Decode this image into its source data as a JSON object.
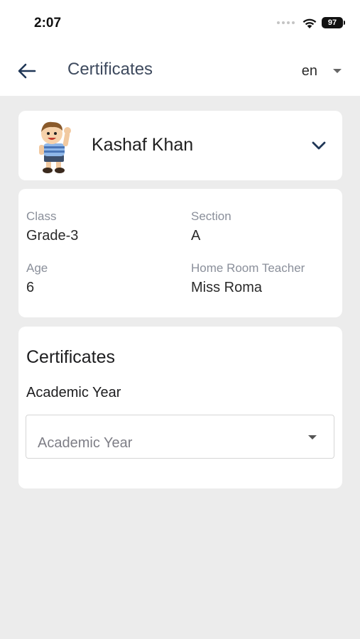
{
  "status_bar": {
    "time": "2:07",
    "battery": "97"
  },
  "app_bar": {
    "title": "Certificates",
    "language": "en"
  },
  "student": {
    "name": "Kashaf Khan"
  },
  "info": {
    "class_label": "Class",
    "class_value": "Grade-3",
    "section_label": "Section",
    "section_value": "A",
    "age_label": "Age",
    "age_value": "6",
    "teacher_label": "Home Room Teacher",
    "teacher_value": "Miss Roma"
  },
  "certificates": {
    "heading": "Certificates",
    "year_label": "Academic Year",
    "year_placeholder": "Academic Year"
  },
  "colors": {
    "background": "#ececec",
    "card": "#ffffff",
    "title": "#3e4a5e",
    "icon": "#1f3656"
  },
  "icons": {
    "back": "arrow-left-icon",
    "expand": "chevron-down-icon",
    "wifi": "wifi-icon"
  }
}
